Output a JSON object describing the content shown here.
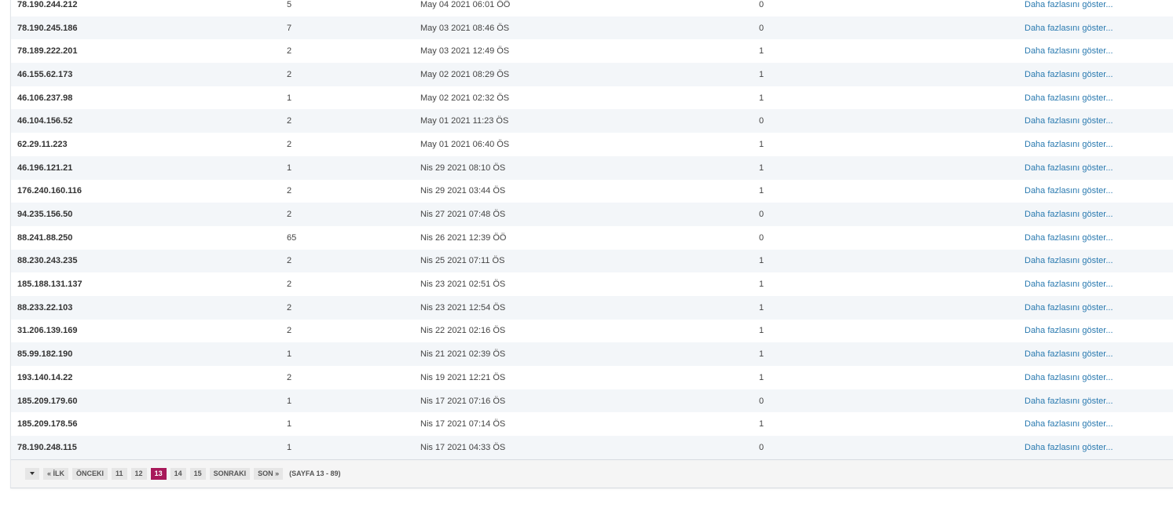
{
  "rows": [
    {
      "ip": "78.190.244.212",
      "count": "5",
      "date": "May 04 2021 06:01 ÖÖ",
      "num": "0",
      "more": "Daha fazlasını göster..."
    },
    {
      "ip": "78.190.245.186",
      "count": "7",
      "date": "May 03 2021 08:46 ÖS",
      "num": "0",
      "more": "Daha fazlasını göster..."
    },
    {
      "ip": "78.189.222.201",
      "count": "2",
      "date": "May 03 2021 12:49 ÖS",
      "num": "1",
      "more": "Daha fazlasını göster..."
    },
    {
      "ip": "46.155.62.173",
      "count": "2",
      "date": "May 02 2021 08:29 ÖS",
      "num": "1",
      "more": "Daha fazlasını göster..."
    },
    {
      "ip": "46.106.237.98",
      "count": "1",
      "date": "May 02 2021 02:32 ÖS",
      "num": "1",
      "more": "Daha fazlasını göster..."
    },
    {
      "ip": "46.104.156.52",
      "count": "2",
      "date": "May 01 2021 11:23 ÖS",
      "num": "0",
      "more": "Daha fazlasını göster..."
    },
    {
      "ip": "62.29.11.223",
      "count": "2",
      "date": "May 01 2021 06:40 ÖS",
      "num": "1",
      "more": "Daha fazlasını göster..."
    },
    {
      "ip": "46.196.121.21",
      "count": "1",
      "date": "Nis 29 2021 08:10 ÖS",
      "num": "1",
      "more": "Daha fazlasını göster..."
    },
    {
      "ip": "176.240.160.116",
      "count": "2",
      "date": "Nis 29 2021 03:44 ÖS",
      "num": "1",
      "more": "Daha fazlasını göster..."
    },
    {
      "ip": "94.235.156.50",
      "count": "2",
      "date": "Nis 27 2021 07:48 ÖS",
      "num": "0",
      "more": "Daha fazlasını göster..."
    },
    {
      "ip": "88.241.88.250",
      "count": "65",
      "date": "Nis 26 2021 12:39 ÖÖ",
      "num": "0",
      "more": "Daha fazlasını göster..."
    },
    {
      "ip": "88.230.243.235",
      "count": "2",
      "date": "Nis 25 2021 07:11 ÖS",
      "num": "1",
      "more": "Daha fazlasını göster..."
    },
    {
      "ip": "185.188.131.137",
      "count": "2",
      "date": "Nis 23 2021 02:51 ÖS",
      "num": "1",
      "more": "Daha fazlasını göster..."
    },
    {
      "ip": "88.233.22.103",
      "count": "2",
      "date": "Nis 23 2021 12:54 ÖS",
      "num": "1",
      "more": "Daha fazlasını göster..."
    },
    {
      "ip": "31.206.139.169",
      "count": "2",
      "date": "Nis 22 2021 02:16 ÖS",
      "num": "1",
      "more": "Daha fazlasını göster..."
    },
    {
      "ip": "85.99.182.190",
      "count": "1",
      "date": "Nis 21 2021 02:39 ÖS",
      "num": "1",
      "more": "Daha fazlasını göster..."
    },
    {
      "ip": "193.140.14.22",
      "count": "2",
      "date": "Nis 19 2021 12:21 ÖS",
      "num": "1",
      "more": "Daha fazlasını göster..."
    },
    {
      "ip": "185.209.179.60",
      "count": "1",
      "date": "Nis 17 2021 07:16 ÖS",
      "num": "0",
      "more": "Daha fazlasını göster..."
    },
    {
      "ip": "185.209.178.56",
      "count": "1",
      "date": "Nis 17 2021 07:14 ÖS",
      "num": "1",
      "more": "Daha fazlasını göster..."
    },
    {
      "ip": "78.190.248.115",
      "count": "1",
      "date": "Nis 17 2021 04:33 ÖS",
      "num": "0",
      "more": "Daha fazlasını göster..."
    }
  ],
  "pager": {
    "first": "« İLK",
    "prev": "ÖNCEKI",
    "pages": [
      "11",
      "12",
      "13",
      "14",
      "15"
    ],
    "current": "13",
    "next": "SONRAKI",
    "last": "SON »",
    "info": "(SAYFA 13 - 89)"
  },
  "colors": {
    "accent": "#a8195a",
    "link": "#2a7ab0",
    "stripe": "#f3f6f9"
  },
  "icons": {
    "pager_menu": "caret-down-icon"
  }
}
